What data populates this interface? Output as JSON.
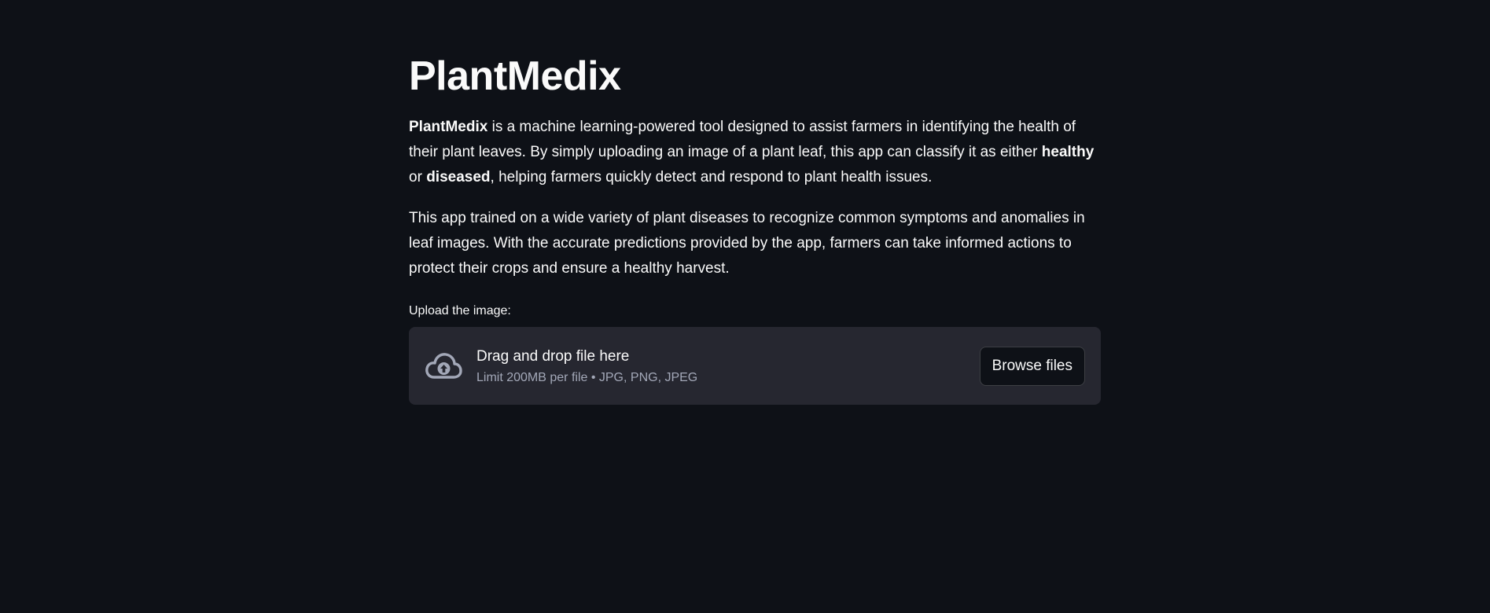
{
  "app": {
    "title": "PlantMedix"
  },
  "intro": {
    "p1_bold_name": "PlantMedix",
    "p1_text_a": " is a machine learning-powered tool designed to assist farmers in identifying the health of their plant leaves. By simply uploading an image of a plant leaf, this app can classify it as either ",
    "p1_bold_healthy": "healthy",
    "p1_text_b": " or ",
    "p1_bold_diseased": "diseased",
    "p1_text_c": ", helping farmers quickly detect and respond to plant health issues.",
    "p2": "This app trained on a wide variety of plant diseases to recognize common symptoms and anomalies in leaf images. With the accurate predictions provided by the app, farmers can take informed actions to protect their crops and ensure a healthy harvest."
  },
  "uploader": {
    "label": "Upload the image:",
    "drop_title": "Drag and drop file here",
    "drop_subtitle": "Limit 200MB per file • JPG, PNG, JPEG",
    "browse_label": "Browse files",
    "icon": "cloud-upload-icon"
  },
  "colors": {
    "background": "#0e1117",
    "dropzone": "#262730",
    "text": "#fafafa",
    "muted": "#a3a8b8"
  }
}
